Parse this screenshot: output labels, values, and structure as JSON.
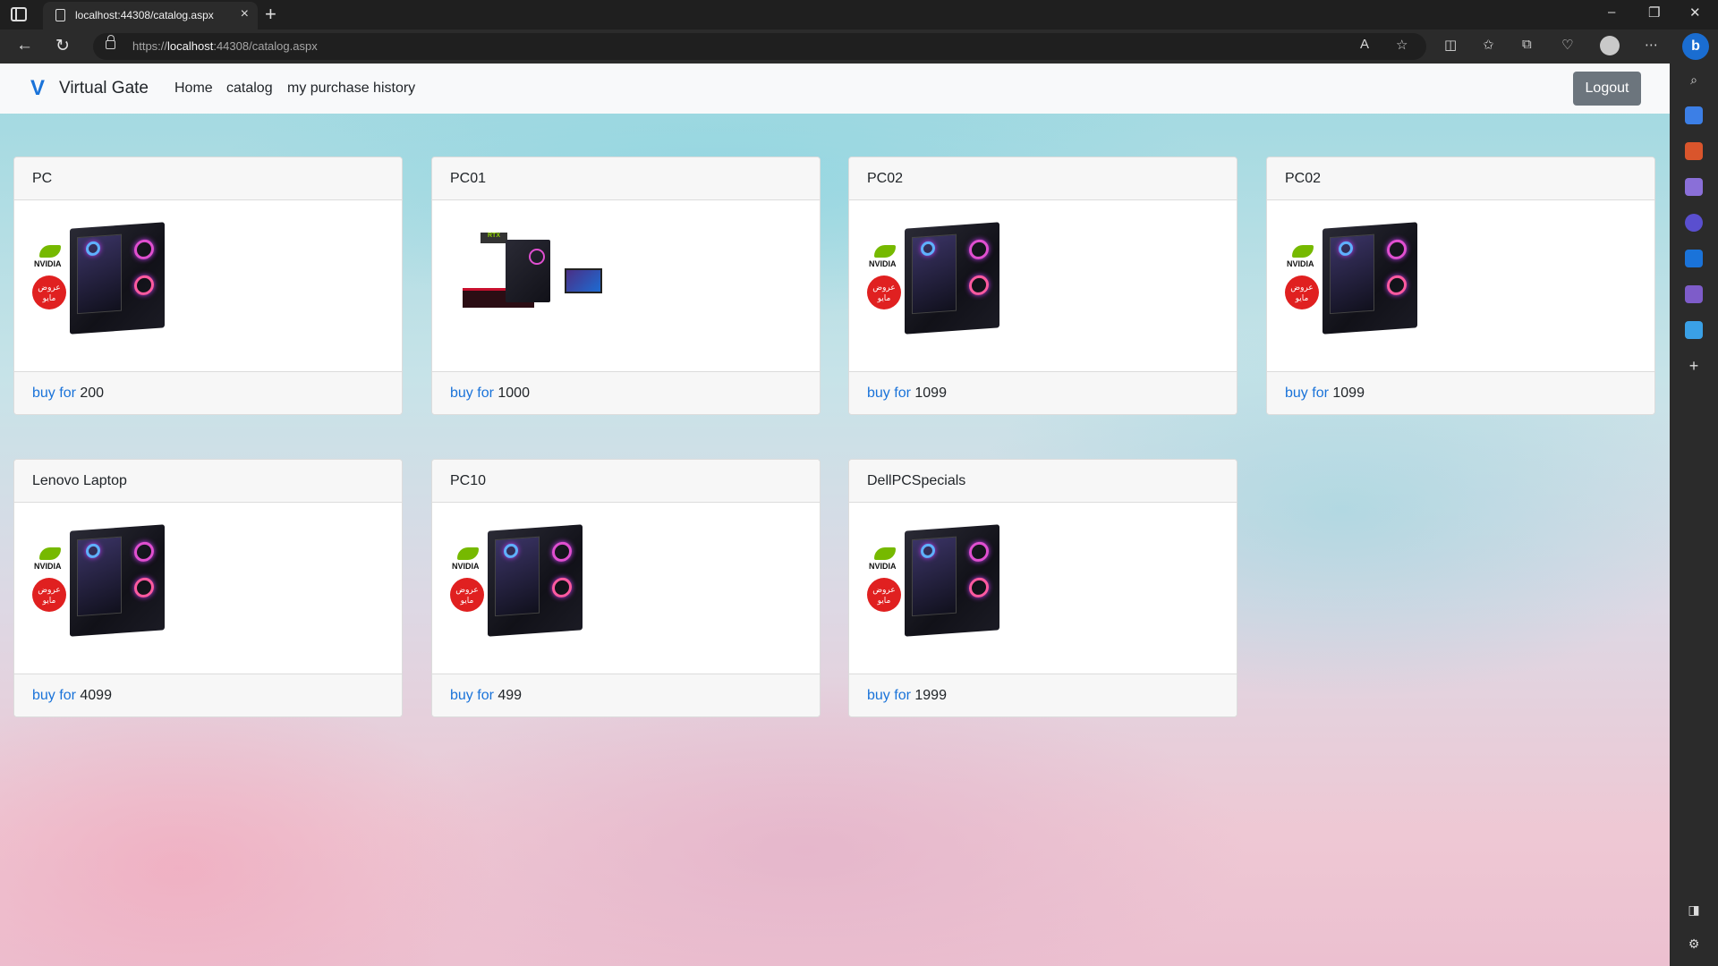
{
  "browser": {
    "tab_title": "localhost:44308/catalog.aspx",
    "url_scheme": "https://",
    "url_host": "localhost",
    "url_rest": ":44308/catalog.aspx",
    "bing_label": "b"
  },
  "site": {
    "brand": "Virtual Gate",
    "brand_logo": "V",
    "nav": {
      "home": "Home",
      "catalog": "catalog",
      "history": "my purchase history"
    },
    "logout": "Logout"
  },
  "catalog": {
    "buy_label": "buy for",
    "nvidia_label": "NVIDIA",
    "offer_label": "عروض مايو",
    "products": [
      {
        "name": "PC",
        "price": "200",
        "image": "gaming-pc-nvidia"
      },
      {
        "name": "PC01",
        "price": "1000",
        "image": "pc-desk-setup"
      },
      {
        "name": "PC02",
        "price": "1099",
        "image": "gaming-pc-nvidia"
      },
      {
        "name": "PC02",
        "price": "1099",
        "image": "gaming-pc-nvidia"
      },
      {
        "name": "Lenovo Laptop",
        "price": "4099",
        "image": "gaming-pc-nvidia"
      },
      {
        "name": "PC10",
        "price": "499",
        "image": "gaming-pc-nvidia"
      },
      {
        "name": "DellPCSpecials",
        "price": "1999",
        "image": "gaming-pc-nvidia"
      }
    ]
  },
  "colors": {
    "link": "#1a73d9",
    "logout_bg": "#6c757d",
    "nvidia_green": "#76b900",
    "offer_red": "#e02020"
  }
}
